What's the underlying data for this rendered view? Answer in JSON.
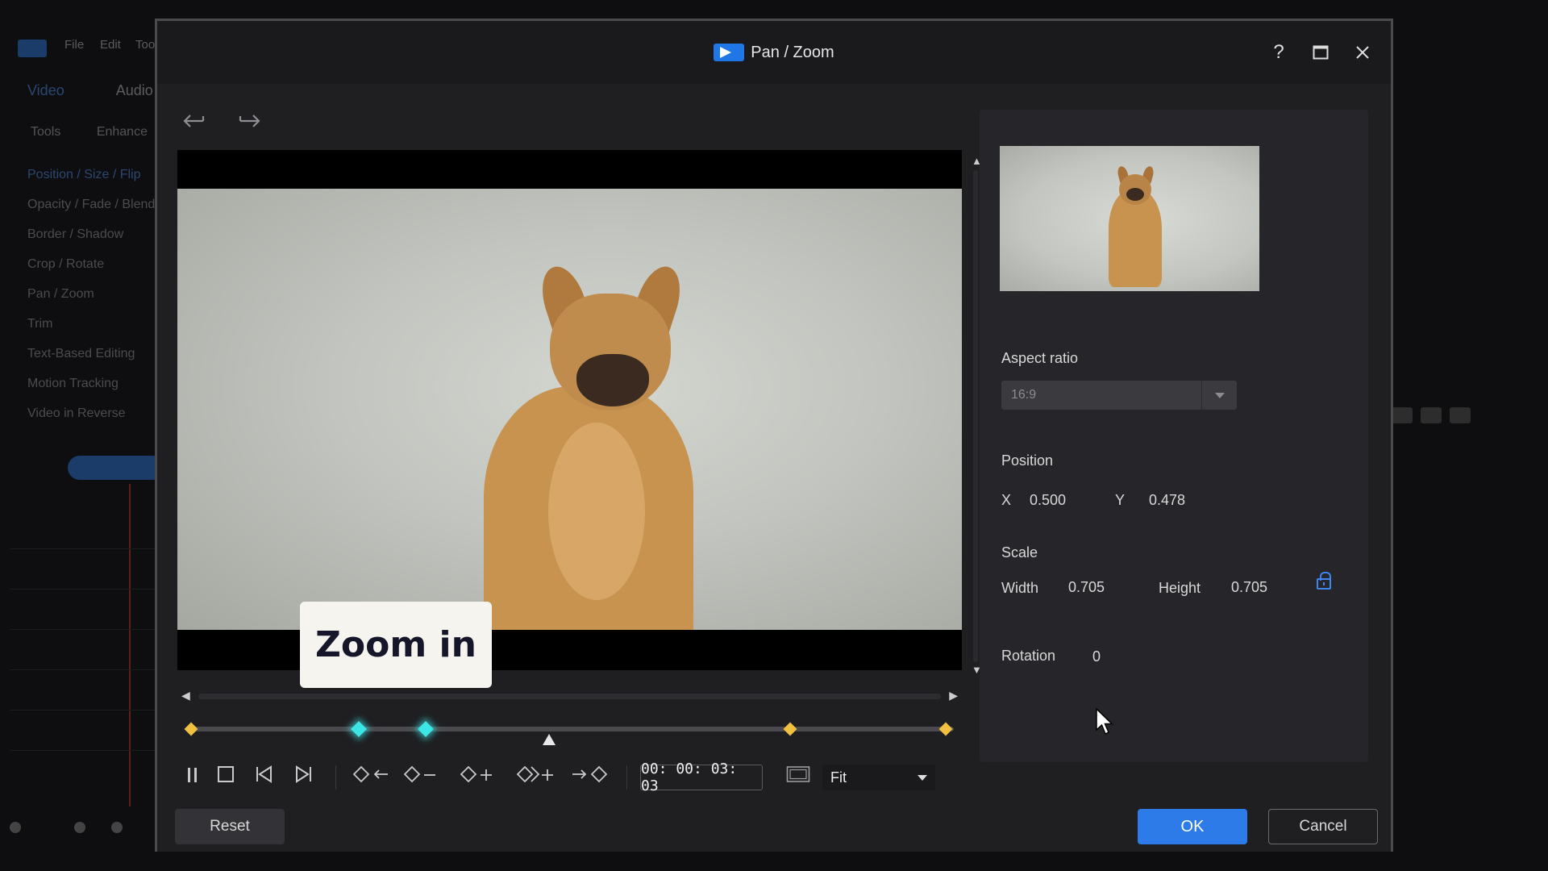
{
  "background_app": {
    "menu": [
      "File",
      "Edit",
      "Tools"
    ],
    "tabs": [
      "Video",
      "Audio"
    ],
    "subtabs": [
      "Tools",
      "Enhance"
    ],
    "tools_list": [
      "Position / Size / Flip",
      "Opacity / Fade / Blend",
      "Border / Shadow",
      "Crop / Rotate",
      "Pan / Zoom",
      "Trim",
      "Text-Based Editing",
      "Motion Tracking",
      "Video in Reverse"
    ]
  },
  "dialog": {
    "title": "Pan / Zoom",
    "controls": {
      "help": "?",
      "maximize": "□",
      "close": "✕"
    },
    "toolbar": {
      "undo_icon": "undo-icon",
      "redo_icon": "redo-icon"
    }
  },
  "preview": {
    "tooltip": "Zoom in"
  },
  "keyframes": {
    "items": [
      {
        "type": "gold"
      },
      {
        "type": "cyan"
      },
      {
        "type": "cyan"
      },
      {
        "type": "gold"
      },
      {
        "type": "gold"
      }
    ]
  },
  "playback": {
    "timecode": "00: 00: 03: 03",
    "fit_value": "Fit"
  },
  "panel": {
    "aspect_ratio_label": "Aspect ratio",
    "aspect_ratio_value": "16:9",
    "position_label": "Position",
    "x_label": "X",
    "x_value": "0.500",
    "y_label": "Y",
    "y_value": "0.478",
    "scale_label": "Scale",
    "width_label": "Width",
    "width_value": "0.705",
    "height_label": "Height",
    "height_value": "0.705",
    "rotation_label": "Rotation",
    "rotation_value": "0"
  },
  "footer": {
    "reset_label": "Reset",
    "ok_label": "OK",
    "cancel_label": "Cancel"
  },
  "colors": {
    "accent": "#2d7be8",
    "keyframe_gold": "#f0c040",
    "keyframe_cyan": "#3de6e6"
  }
}
